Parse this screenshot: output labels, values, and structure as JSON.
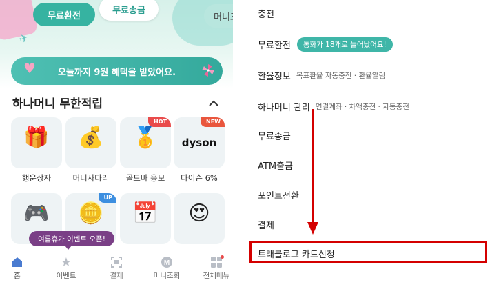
{
  "left": {
    "top_pills": {
      "exchange": "무료환전",
      "send": "무료송금",
      "money_partial": "머니조회"
    },
    "banner": {
      "text": "오늘까지 9원 혜택을 받았어요."
    },
    "section": {
      "title": "하나머니 무한적립"
    },
    "cards": [
      {
        "label": "행운상자",
        "icon": "gift-box-icon",
        "glyph": "🎁",
        "badge": ""
      },
      {
        "label": "머니사다리",
        "icon": "money-bag-icon",
        "glyph": "💰",
        "badge": ""
      },
      {
        "label": "골드바 응모",
        "icon": "gold-bar-icon",
        "glyph": "🥇",
        "badge": "HOT"
      },
      {
        "label": "다이슨 6%",
        "icon": "dyson-logo",
        "text": "dyson",
        "badge": "NEW"
      },
      {
        "label": "",
        "icon": "game-console-icon",
        "glyph": "🎮",
        "badge": ""
      },
      {
        "label": "",
        "icon": "coins-icon",
        "glyph": "🪙",
        "badge": "UP"
      },
      {
        "label": "",
        "icon": "calendar-icon",
        "glyph": "📅",
        "badge": ""
      },
      {
        "label": "",
        "icon": "heart-eyes-icon",
        "glyph": "😍",
        "badge": ""
      }
    ],
    "tooltip": "여름휴가 이벤트 오픈!",
    "tabs": [
      {
        "label": "홈",
        "icon": "home-icon"
      },
      {
        "label": "이벤트",
        "icon": "star-icon"
      },
      {
        "label": "결제",
        "icon": "scan-icon"
      },
      {
        "label": "머니조회",
        "icon": "money-coin-icon"
      },
      {
        "label": "전체메뉴",
        "icon": "grid-menu-icon"
      }
    ]
  },
  "right": {
    "menu": [
      {
        "label": "충전",
        "sub": "",
        "tag": ""
      },
      {
        "label": "무료환전",
        "sub": "",
        "tag": "통화가 18개로 늘어났어요!"
      },
      {
        "label": "환율정보",
        "sub": "목표환율 자동충전 · 환율알림",
        "tag": ""
      },
      {
        "label": "하나머니 관리",
        "sub": "연결계좌 · 차액충전 · 자동충전",
        "tag": ""
      },
      {
        "label": "무료송금",
        "sub": "",
        "tag": ""
      },
      {
        "label": "ATM출금",
        "sub": "",
        "tag": ""
      },
      {
        "label": "포인트전환",
        "sub": "",
        "tag": ""
      },
      {
        "label": "결제",
        "sub": "",
        "tag": ""
      },
      {
        "label": "트래블로그 카드신청",
        "sub": "",
        "tag": ""
      }
    ]
  },
  "colors": {
    "accent": "#36b3a1",
    "highlight": "#d40000",
    "tooltip": "#7a3f86",
    "badge": "#e94b4b"
  }
}
